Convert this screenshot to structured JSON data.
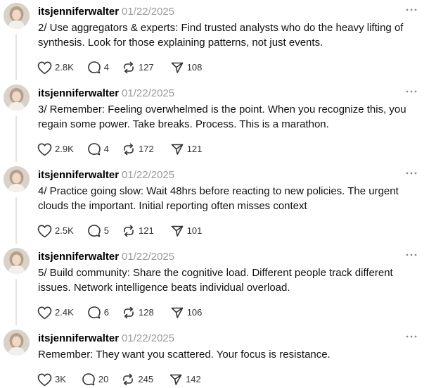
{
  "posts": [
    {
      "username": "itsjenniferwalter",
      "date": "01/22/2025",
      "text": "2/ Use aggregators & experts: Find trusted analysts who do the heavy lifting of synthesis. Look for those explaining patterns, not just events.",
      "likes": "2.8K",
      "replies": "4",
      "reposts": "127",
      "shares": "108"
    },
    {
      "username": "itsjenniferwalter",
      "date": "01/22/2025",
      "text": "3/ Remember: Feeling overwhelmed is the point. When you recognize this, you regain some power. Take breaks. Process. This is a marathon.",
      "likes": "2.9K",
      "replies": "4",
      "reposts": "172",
      "shares": "121"
    },
    {
      "username": "itsjenniferwalter",
      "date": "01/22/2025",
      "text": "4/ Practice going slow: Wait 48hrs before reacting to new policies. The urgent clouds the important. Initial reporting often misses context",
      "likes": "2.5K",
      "replies": "5",
      "reposts": "121",
      "shares": "101"
    },
    {
      "username": "itsjenniferwalter",
      "date": "01/22/2025",
      "text": "5/ Build community: Share the cognitive load. Different people track different issues. Network intelligence beats individual overload.",
      "likes": "2.4K",
      "replies": "6",
      "reposts": "128",
      "shares": "106"
    },
    {
      "username": "itsjenniferwalter",
      "date": "01/22/2025",
      "text": "Remember: They want you scattered. Your focus is resistance.",
      "likes": "3K",
      "replies": "20",
      "reposts": "245",
      "shares": "142"
    }
  ],
  "icons": {
    "like": "heart-icon",
    "reply": "comment-icon",
    "repost": "repost-icon",
    "share": "send-icon",
    "more": "more-icon",
    "avatar": "avatar"
  },
  "colors": {
    "text": "#111111",
    "date": "#9a9a9a",
    "thread_line": "#e2e2e2",
    "icon": "#333333"
  }
}
